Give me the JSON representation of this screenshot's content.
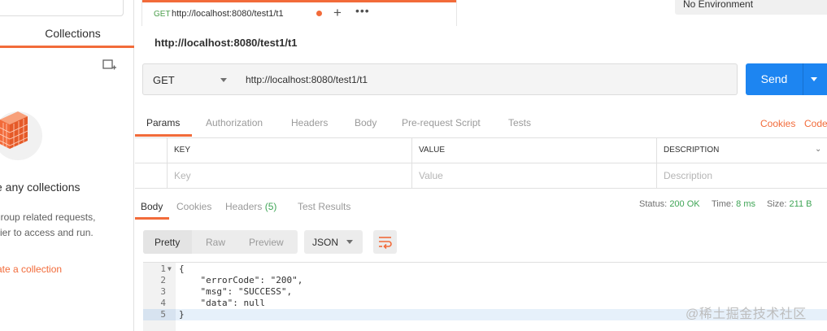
{
  "sidebar": {
    "tab_label": "Collections",
    "empty_title": "ve any collections",
    "empty_desc_line1": "group related requests,",
    "empty_desc_line2": "sier to access and run.",
    "create_link": "ate a collection"
  },
  "tabstrip": {
    "request_tab": {
      "method": "GET",
      "url": "http://localhost:8080/test1/t1"
    },
    "add_tab": "+",
    "more_tabs": "•••",
    "environment": "No Environment"
  },
  "request": {
    "title": "http://localhost:8080/test1/t1",
    "method": "GET",
    "url": "http://localhost:8080/test1/t1",
    "send_label": "Send"
  },
  "request_tabs": {
    "params": "Params",
    "authorization": "Authorization",
    "headers": "Headers",
    "body": "Body",
    "prerequest": "Pre-request Script",
    "tests": "Tests",
    "cookies": "Cookies",
    "code": "Code"
  },
  "params_table": {
    "headers": {
      "key": "KEY",
      "value": "VALUE",
      "description": "DESCRIPTION"
    },
    "placeholders": {
      "key": "Key",
      "value": "Value",
      "description": "Description"
    }
  },
  "response_tabs": {
    "body": "Body",
    "cookies": "Cookies",
    "headers": "Headers",
    "headers_count": "(5)",
    "test_results": "Test Results"
  },
  "response_meta": {
    "status_label": "Status:",
    "status_value": "200 OK",
    "time_label": "Time:",
    "time_value": "8 ms",
    "size_label": "Size:",
    "size_value": "211 B"
  },
  "response_toolbar": {
    "pretty": "Pretty",
    "raw": "Raw",
    "preview": "Preview",
    "format": "JSON"
  },
  "response_body": {
    "lines": [
      {
        "num": "1",
        "text": "{"
      },
      {
        "num": "2",
        "text": "    \"errorCode\": \"200\","
      },
      {
        "num": "3",
        "text": "    \"msg\": \"SUCCESS\","
      },
      {
        "num": "4",
        "text": "    \"data\": null"
      },
      {
        "num": "5",
        "text": "}"
      }
    ]
  },
  "watermark": "@稀土掘金技术社区",
  "colors": {
    "accent": "#f26b3a",
    "send": "#1d85f1",
    "success": "#3fa556"
  }
}
